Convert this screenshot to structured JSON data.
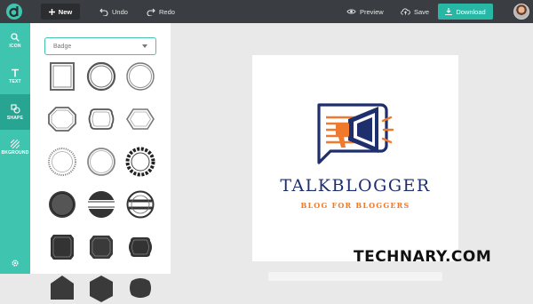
{
  "toolbar": {
    "new_label": "New",
    "undo_label": "Undo",
    "redo_label": "Redo",
    "preview_label": "Preview",
    "save_label": "Save",
    "download_label": "Download"
  },
  "sidebar": {
    "items": [
      {
        "label": "ICON",
        "icon": "search-icon"
      },
      {
        "label": "TEXT",
        "icon": "text-icon"
      },
      {
        "label": "SHAPE",
        "icon": "shape-icon"
      },
      {
        "label": "BKGROUND",
        "icon": "background-icon"
      },
      {
        "label": "",
        "icon": "gear-icon"
      }
    ]
  },
  "panel": {
    "category_select": "Badge"
  },
  "canvas": {
    "brand_name": "TALKBLOGGER",
    "tagline": "BLOG FOR BLOGGERS"
  },
  "watermark": "TECHNARY.COM",
  "colors": {
    "topbar": "#3a3d41",
    "sidebar": "#3fc4b0",
    "accent": "#27b7a4",
    "brand_navy": "#1e2f6e",
    "brand_orange": "#f07a2b"
  }
}
